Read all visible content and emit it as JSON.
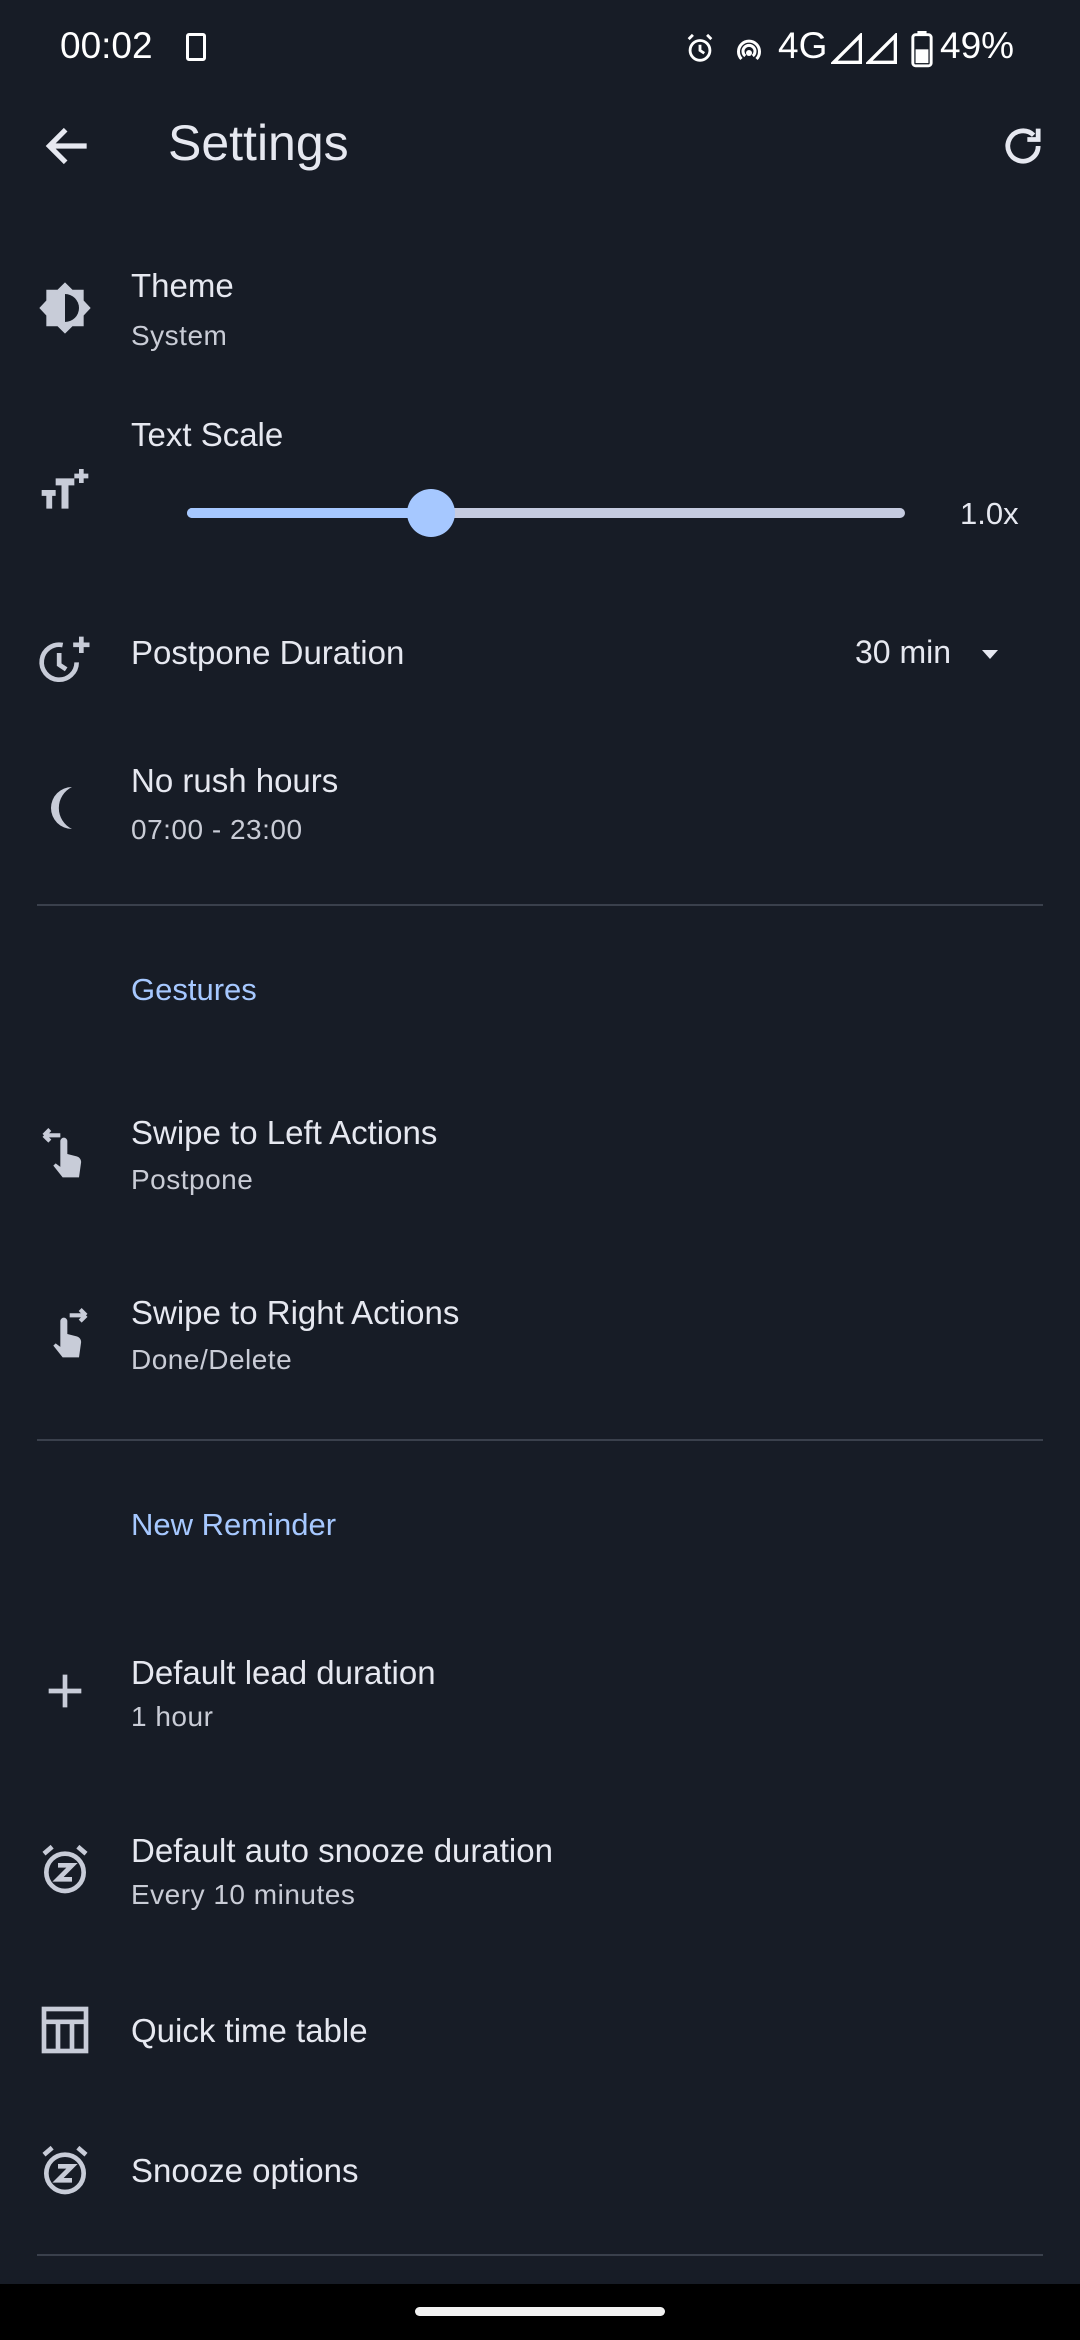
{
  "status_bar": {
    "time": "00:02",
    "network": "4G",
    "battery": "49%"
  },
  "app_bar": {
    "title": "Settings"
  },
  "settings": {
    "theme": {
      "title": "Theme",
      "value": "System"
    },
    "text_scale": {
      "title": "Text Scale",
      "value_label": "1.0x",
      "slider_fraction": 0.34
    },
    "postpone": {
      "title": "Postpone Duration",
      "value": "30 min"
    },
    "no_rush": {
      "title": "No rush hours",
      "value": "07:00 - 23:00"
    }
  },
  "gestures": {
    "header": "Gestures",
    "swipe_left": {
      "title": "Swipe to Left Actions",
      "value": "Postpone"
    },
    "swipe_right": {
      "title": "Swipe to Right Actions",
      "value": "Done/Delete"
    }
  },
  "new_reminder": {
    "header": "New Reminder",
    "lead": {
      "title": "Default lead duration",
      "value": "1 hour"
    },
    "auto_snooze": {
      "title": "Default auto snooze duration",
      "value": "Every 10 minutes"
    },
    "quick_table": {
      "title": "Quick time table"
    },
    "snooze_options": {
      "title": "Snooze options"
    }
  },
  "colors": {
    "background": "#171c26",
    "accent": "#a6c8ff",
    "slider_active": "#a6c8ff",
    "slider_inactive": "#c5cbe0"
  },
  "icons": [
    "back-arrow-icon",
    "refresh-icon",
    "brightness-icon",
    "text-size-icon",
    "clock-plus-icon",
    "moon-icon",
    "swipe-left-icon",
    "swipe-right-icon",
    "plus-icon",
    "snooze-icon",
    "table-icon"
  ]
}
